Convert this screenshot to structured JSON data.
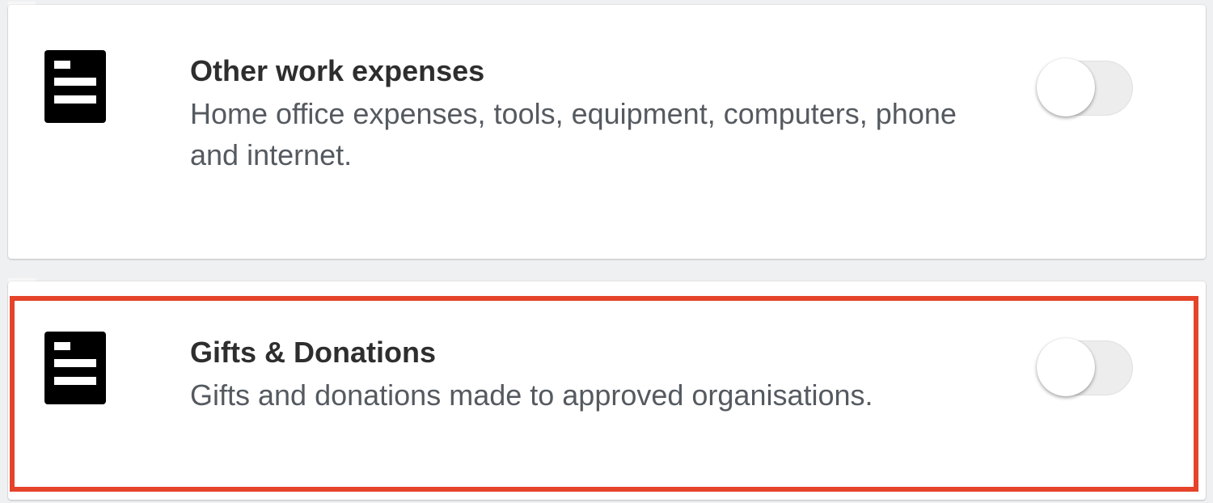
{
  "items": [
    {
      "icon": "document-list-icon",
      "title": "Other work expenses",
      "description": "Home office expenses, tools, equipment, computers, phone and internet.",
      "enabled": false
    },
    {
      "icon": "document-list-icon",
      "title": "Gifts & Donations",
      "description": "Gifts and donations made to approved organisations.",
      "enabled": false,
      "highlighted": true
    }
  ],
  "colors": {
    "highlight_border": "#e5432a",
    "page_background": "#eff0f2",
    "card_background": "#ffffff",
    "icon": "#000000"
  }
}
